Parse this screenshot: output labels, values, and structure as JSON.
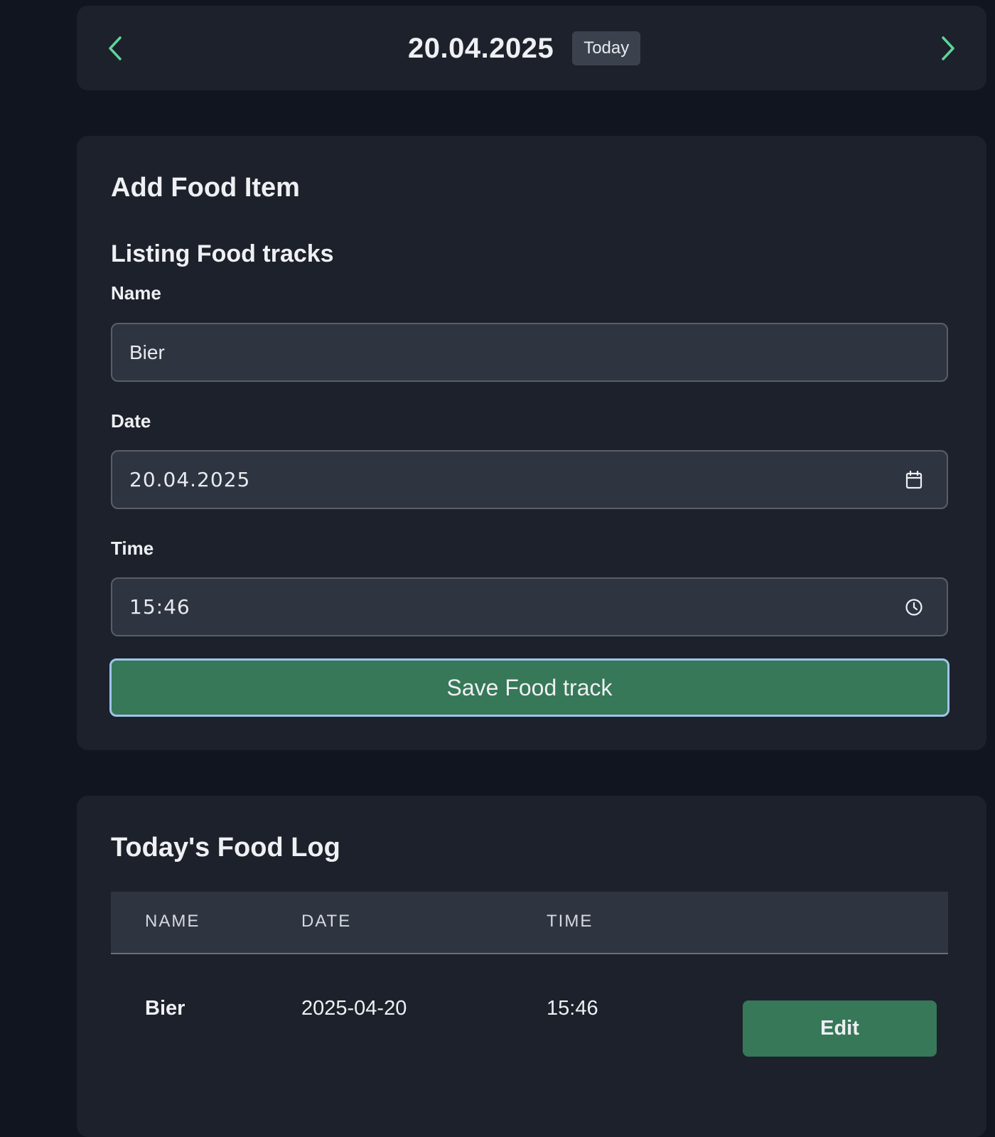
{
  "date_nav": {
    "current_date": "20.04.2025",
    "today_label": "Today",
    "prev_icon": "chevron-left-icon",
    "next_icon": "chevron-right-icon",
    "accent_color": "#5fd39a"
  },
  "add_food": {
    "title": "Add Food Item",
    "subtitle": "Listing Food tracks",
    "name_label": "Name",
    "name_value": "Bier",
    "date_label": "Date",
    "date_value": "20.04.2025",
    "date_icon": "calendar-icon",
    "time_label": "Time",
    "time_value": "15:46",
    "time_icon": "clock-icon",
    "save_label": "Save Food track",
    "button_color": "#367858"
  },
  "food_log": {
    "title": "Today's Food Log",
    "columns": [
      "NAME",
      "DATE",
      "TIME"
    ],
    "rows": [
      {
        "name": "Bier",
        "date": "2025-04-20",
        "time": "15:46",
        "action_label": "Edit"
      }
    ]
  }
}
